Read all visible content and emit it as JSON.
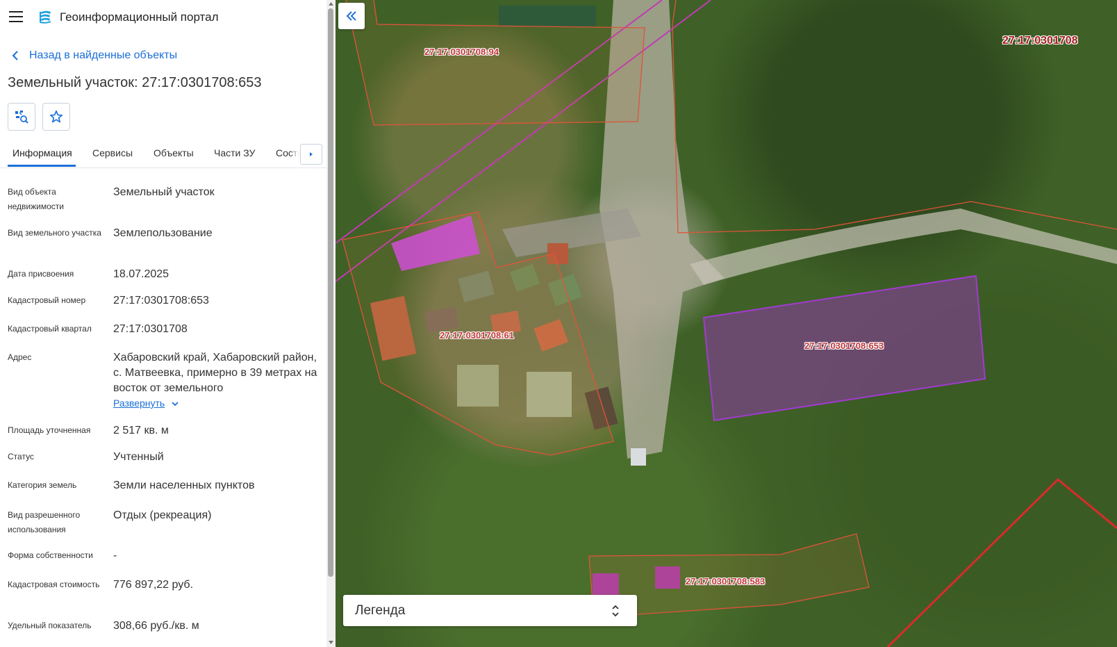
{
  "header": {
    "title": "Геоинформационный портал"
  },
  "nav": {
    "back_label": "Назад в найденные объекты"
  },
  "object": {
    "title": "Земельный участок: 27:17:0301708:653"
  },
  "tabs": [
    {
      "label": "Информация"
    },
    {
      "label": "Сервисы"
    },
    {
      "label": "Объекты"
    },
    {
      "label": "Части ЗУ"
    },
    {
      "label": "Соста"
    }
  ],
  "properties": [
    {
      "label": "Вид объекта недвижимости",
      "value": "Земельный участок"
    },
    {
      "label": "Вид земельного участка",
      "value": "Землепользование"
    },
    {
      "label": "Дата присвоения",
      "value": "18.07.2025"
    },
    {
      "label": "Кадастровый номер",
      "value": "27:17:0301708:653"
    },
    {
      "label": "Кадастровый квартал",
      "value": "27:17:0301708"
    },
    {
      "label": "Адрес",
      "value": "Хабаровский край, Хабаровский район, с. Матвеевка, примерно в 39 метрах на восток от земельного"
    },
    {
      "label": "Площадь уточненная",
      "value": "2 517 кв. м"
    },
    {
      "label": "Статус",
      "value": "Учтенный"
    },
    {
      "label": "Категория земель",
      "value": "Земли населенных пунктов"
    },
    {
      "label": "Вид разрешенного использования",
      "value": "Отдых (рекреация)"
    },
    {
      "label": "Форма собственности",
      "value": "-"
    },
    {
      "label": "Кадастровая стоимость",
      "value": "776 897,22 руб."
    },
    {
      "label": "Удельный показатель",
      "value": "308,66 руб./кв. м"
    }
  ],
  "address_expand": {
    "label": "Развернуть"
  },
  "map": {
    "legend_label": "Легенда",
    "parcels": [
      {
        "label": "27:17:0301708:94"
      },
      {
        "label": "27:17:0301708:61"
      },
      {
        "label": "27:17:0301708:653"
      },
      {
        "label": "27:17:0301708:583"
      }
    ],
    "quarter_label": "27:17:0301708"
  },
  "colors": {
    "accent": "#1b6fd8",
    "parcel_outline": "#e0533a",
    "selected_parcel": "#8e3aa8",
    "building_fill": "#d04fd6",
    "quarter_boundary": "#d92b2b"
  },
  "icons": {
    "menu": "menu-icon",
    "logo": "portal-logo-icon",
    "back": "chevron-left-icon",
    "search_on_map": "map-search-icon",
    "favorite": "star-icon",
    "tabs_scroll": "chevron-right-icon",
    "expand": "chevron-down-icon",
    "collapse_panel": "double-chevron-left-icon",
    "legend_toggle": "unfold-icon"
  }
}
